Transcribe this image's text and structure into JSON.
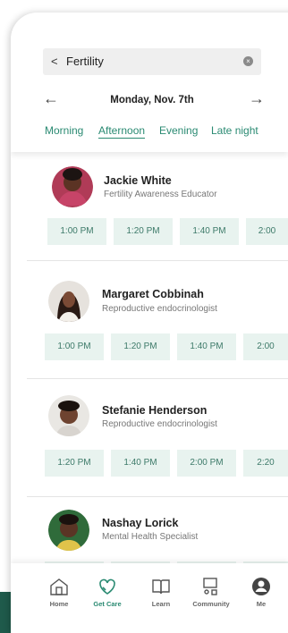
{
  "search": {
    "query": "Fertility"
  },
  "date_nav": {
    "date": "Monday, Nov. 7th",
    "prev_glyph": "←",
    "next_glyph": "→"
  },
  "time_tabs": [
    "Morning",
    "Afternoon",
    "Evening",
    "Late night"
  ],
  "active_tab": "Afternoon",
  "providers": [
    {
      "name": "Jackie White",
      "role": "Fertility Awareness Educator",
      "slots": [
        "1:00 PM",
        "1:20 PM",
        "1:40 PM",
        "2:00"
      ]
    },
    {
      "name": "Margaret Cobbinah",
      "role": "Reproductive endocrinologist",
      "slots": [
        "1:00 PM",
        "1:20 PM",
        "1:40 PM",
        "2:00"
      ]
    },
    {
      "name": "Stefanie Henderson",
      "role": "Reproductive endocrinologist",
      "slots": [
        "1:20 PM",
        "1:40 PM",
        "2:00 PM",
        "2:20"
      ]
    },
    {
      "name": "Nashay Lorick",
      "role": "Mental Health Specialist",
      "slots": []
    }
  ],
  "bottom_nav": [
    {
      "label": "Home",
      "icon": "home-icon"
    },
    {
      "label": "Get Care",
      "icon": "heart-hands-icon",
      "active": true
    },
    {
      "label": "Learn",
      "icon": "book-icon"
    },
    {
      "label": "Community",
      "icon": "community-icon"
    },
    {
      "label": "Me",
      "icon": "profile-icon"
    }
  ],
  "colors": {
    "accent": "#2a8a72",
    "slot_bg": "#e8f3ef",
    "brand_dark": "#1f5a4b"
  }
}
